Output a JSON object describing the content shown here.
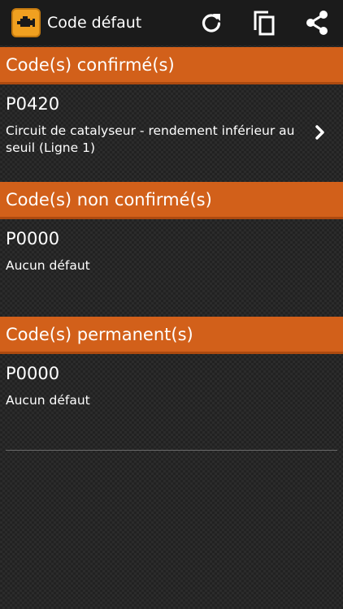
{
  "appbar": {
    "title": "Code défaut",
    "icons": {
      "app": "engine-icon",
      "refresh": "refresh-icon",
      "copy": "copy-icon",
      "share": "share-icon"
    }
  },
  "colors": {
    "section_header": "#d2601a",
    "appbar": "#1b1b1b",
    "app_icon": "#f0a020"
  },
  "sections": [
    {
      "header": "Code(s) confirmé(s)",
      "items": [
        {
          "code": "P0420",
          "description": "Circuit de catalyseur - rendement inférieur au seuil (Ligne 1)"
        }
      ]
    },
    {
      "header": "Code(s) non confirmé(s)",
      "items": [
        {
          "code": "P0000",
          "description": "Aucun défaut"
        }
      ]
    },
    {
      "header": "Code(s) permanent(s)",
      "items": [
        {
          "code": "P0000",
          "description": "Aucun défaut"
        }
      ]
    }
  ]
}
